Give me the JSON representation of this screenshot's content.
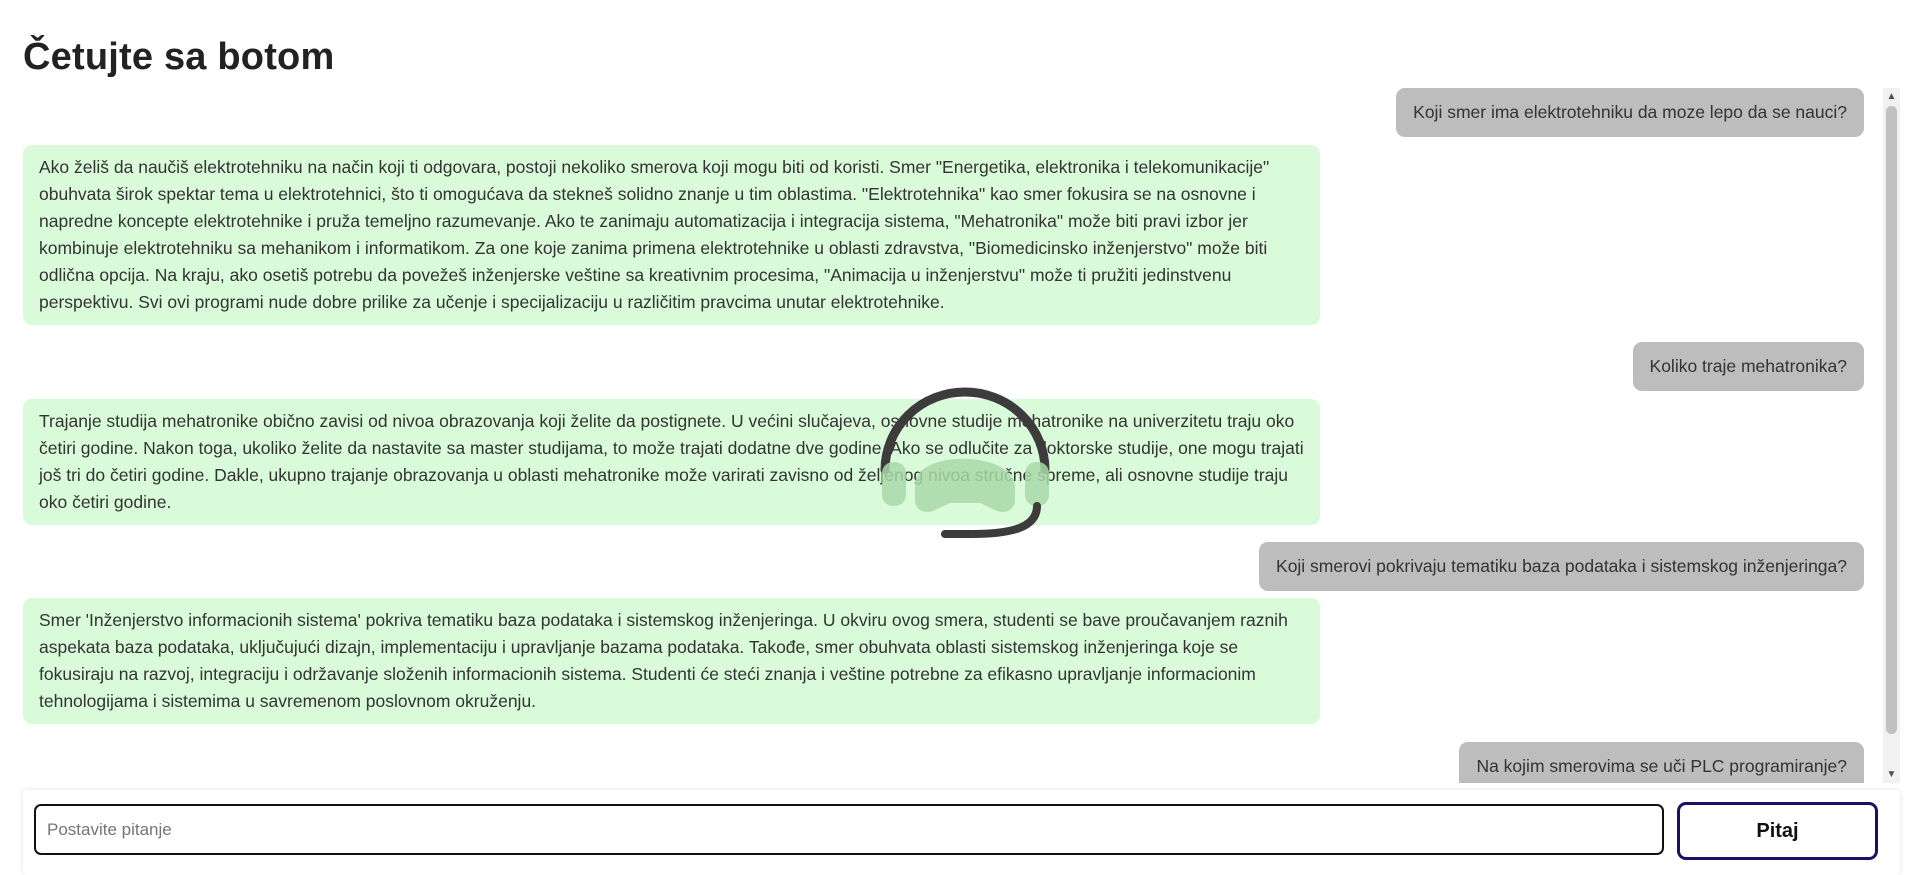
{
  "header": {
    "title": "Četujte sa botom"
  },
  "messages": [
    {
      "role": "user",
      "text": "Koji smer ima elektrotehniku da moze lepo da se nauci?"
    },
    {
      "role": "bot",
      "text": " Ako želiš da naučiš elektrotehniku na način koji ti odgovara, postoji nekoliko smerova koji mogu biti od koristi. Smer \"Energetika, elektronika i telekomunikacije\" obuhvata širok spektar tema u elektrotehnici, što ti omogućava da stekneš solidno znanje u tim oblastima. \"Elektrotehnika\" kao smer fokusira se na osnovne i napredne koncepte elektrotehnike i pruža temeljno razumevanje. Ako te zanimaju automatizacija i integracija sistema, \"Mehatronika\" može biti pravi izbor jer kombinuje elektrotehniku sa mehanikom i informatikom. Za one koje zanima primena elektrotehnike u oblasti zdravstva, \"Biomedicinsko inženjerstvo\" može biti odlična opcija. Na kraju, ako osetiš potrebu da povežeš inženjerske veštine sa kreativnim procesima, \"Animacija u inženjerstvu\" može ti pružiti jedinstvenu perspektivu. Svi ovi programi nude dobre prilike za učenje i specijalizaciju u različitim pravcima unutar elektrotehnike."
    },
    {
      "role": "user",
      "text": "Koliko traje mehatronika?"
    },
    {
      "role": "bot",
      "text": " Trajanje studija mehatronike obično zavisi od nivoa obrazovanja koji želite da postignete. U većini slučajeva, osnovne studije mehatronike na univerzitetu traju oko četiri godine. Nakon toga, ukoliko želite da nastavite sa master studijama, to može trajati dodatne dve godine. Ako se odlučite za doktorske studije, one mogu trajati još tri do četiri godine. Dakle, ukupno trajanje obrazovanja u oblasti mehatronike može varirati zavisno od željenog nivoa stručne spreme, ali osnovne studije traju oko četiri godine."
    },
    {
      "role": "user",
      "text": "Koji smerovi pokrivaju tematiku baza podataka i sistemskog inženjeringa?"
    },
    {
      "role": "bot",
      "text": " Smer 'Inženjerstvo informacionih sistema' pokriva tematiku baza podataka i sistemskog inženjeringa. U okviru ovog smera, studenti se bave proučavanjem raznih aspekata baza podataka, uključujući dizajn, implementaciju i upravljanje bazama podataka. Takođe, smer obuhvata oblasti sistemskog inženjeringa koje se fokusiraju na razvoj, integraciju i održavanje složenih informacionih sistema. Studenti će steći znanja i veštine potrebne za efikasno upravljanje informacionim tehnologijama i sistemima u savremenom poslovnom okruženju."
    },
    {
      "role": "user",
      "text": "Na kojim smerovima se uči PLC programiranje?"
    }
  ],
  "composer": {
    "placeholder": "Postavite pitanje",
    "value": "",
    "submit_label": "Pitaj"
  },
  "icons": {
    "watermark": "chatbot-headset-icon",
    "scroll_up": "arrow-up-icon",
    "scroll_down": "arrow-down-icon"
  },
  "colors": {
    "user_bubble": "#bdbdbd",
    "bot_bubble": "#d9fbd9",
    "button_border": "#1a1066"
  }
}
